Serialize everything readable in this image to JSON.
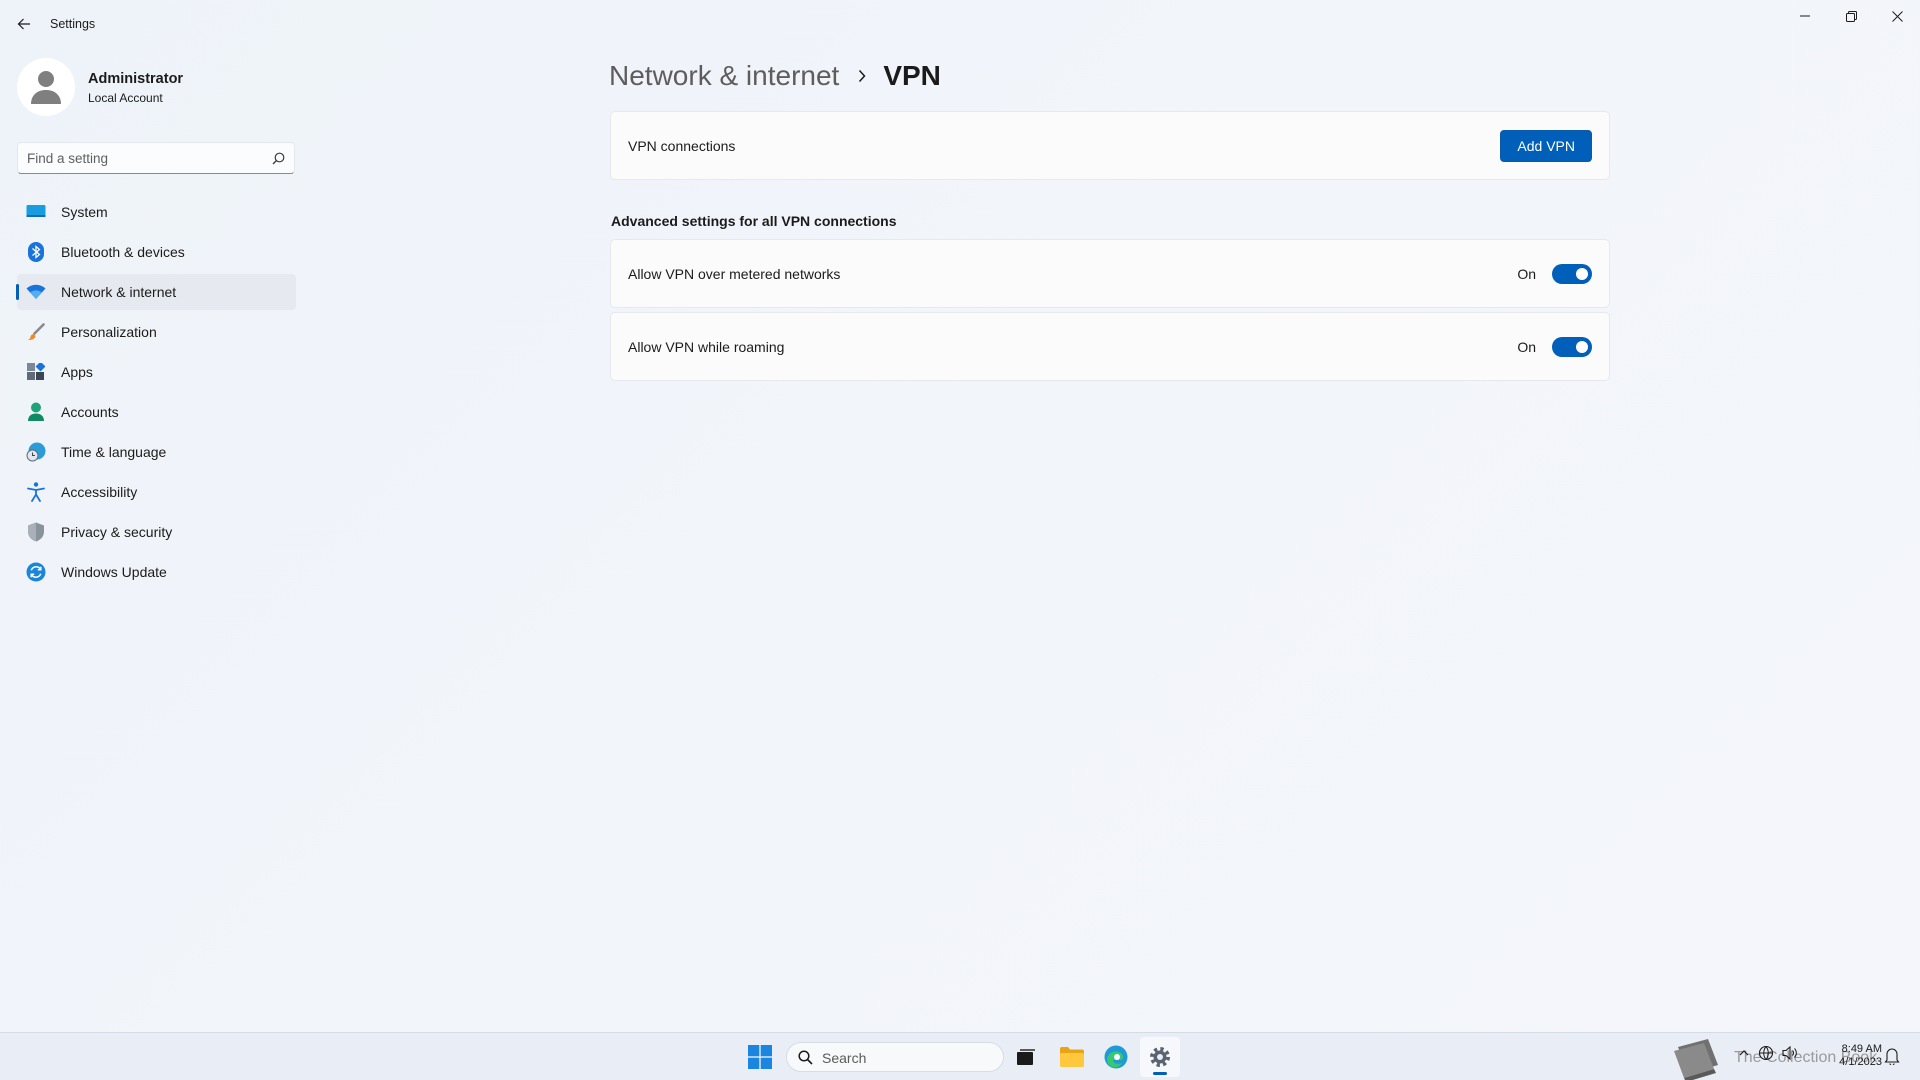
{
  "window": {
    "title": "Settings"
  },
  "user": {
    "name": "Administrator",
    "account_type": "Local Account"
  },
  "search": {
    "placeholder": "Find a setting"
  },
  "sidebar": {
    "items": [
      {
        "label": "System",
        "icon": "system-icon"
      },
      {
        "label": "Bluetooth & devices",
        "icon": "bluetooth-icon"
      },
      {
        "label": "Network & internet",
        "icon": "wifi-icon",
        "active": true
      },
      {
        "label": "Personalization",
        "icon": "brush-icon"
      },
      {
        "label": "Apps",
        "icon": "apps-icon"
      },
      {
        "label": "Accounts",
        "icon": "accounts-icon"
      },
      {
        "label": "Time & language",
        "icon": "globe-clock-icon"
      },
      {
        "label": "Accessibility",
        "icon": "accessibility-icon"
      },
      {
        "label": "Privacy & security",
        "icon": "shield-icon"
      },
      {
        "label": "Windows Update",
        "icon": "update-icon"
      }
    ]
  },
  "breadcrumb": {
    "parent": "Network & internet",
    "current": "VPN"
  },
  "vpn": {
    "connections_label": "VPN connections",
    "add_button": "Add VPN"
  },
  "advanced": {
    "title": "Advanced settings for all VPN connections",
    "settings": [
      {
        "label": "Allow VPN over metered networks",
        "state": "On",
        "enabled": true
      },
      {
        "label": "Allow VPN while roaming",
        "state": "On",
        "enabled": true
      }
    ]
  },
  "taskbar": {
    "search_label": "Search",
    "watermark": "The Collection Book",
    "time": "8:49 AM",
    "date": "4/1/2023"
  },
  "colors": {
    "accent": "#005fb8",
    "background": "#f3f6fb"
  }
}
